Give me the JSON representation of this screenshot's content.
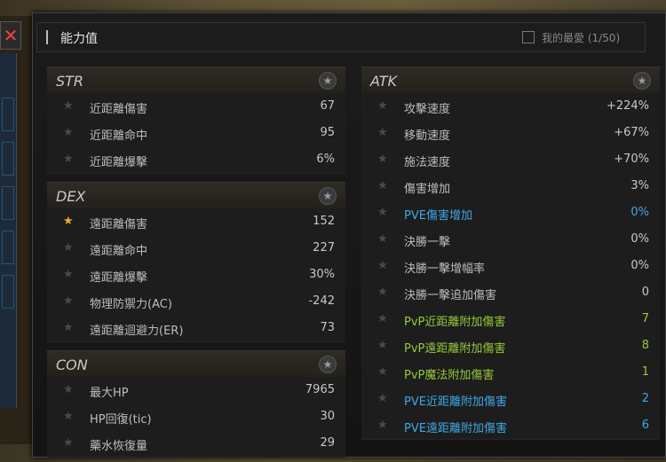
{
  "window": {
    "title": "能力值",
    "favorites_label": "我的最愛 (1/50)"
  },
  "sections": {
    "str": {
      "title": "STR",
      "rows": [
        {
          "label": "近距離傷害",
          "value": "67",
          "starred": false
        },
        {
          "label": "近距離命中",
          "value": "95",
          "starred": false
        },
        {
          "label": "近距離爆擊",
          "value": "6%",
          "starred": false
        }
      ]
    },
    "dex": {
      "title": "DEX",
      "rows": [
        {
          "label": "遠距離傷害",
          "value": "152",
          "starred": true
        },
        {
          "label": "遠距離命中",
          "value": "227",
          "starred": false
        },
        {
          "label": "遠距離爆擊",
          "value": "30%",
          "starred": false
        },
        {
          "label": "物理防禦力(AC)",
          "value": "-242",
          "starred": false
        },
        {
          "label": "遠距離迴避力(ER)",
          "value": "73",
          "starred": false
        }
      ]
    },
    "con": {
      "title": "CON",
      "rows": [
        {
          "label": "最大HP",
          "value": "7965",
          "starred": false
        },
        {
          "label": "HP回復(tic)",
          "value": "30",
          "starred": false
        },
        {
          "label": "藥水恢復量",
          "value": "29",
          "starred": false
        }
      ]
    },
    "atk": {
      "title": "ATK",
      "rows": [
        {
          "label": "攻擊速度",
          "value": "+224%",
          "color": "normal"
        },
        {
          "label": "移動速度",
          "value": "+67%",
          "color": "normal"
        },
        {
          "label": "施法速度",
          "value": "+70%",
          "color": "normal"
        },
        {
          "label": "傷害增加",
          "value": "3%",
          "color": "normal"
        },
        {
          "label": "PVE傷害增加",
          "value": "0%",
          "color": "blue"
        },
        {
          "label": "決勝一擊",
          "value": "0%",
          "color": "normal"
        },
        {
          "label": "決勝一擊增幅率",
          "value": "0%",
          "color": "normal"
        },
        {
          "label": "決勝一擊追加傷害",
          "value": "0",
          "color": "normal"
        },
        {
          "label": "PvP近距離附加傷害",
          "value": "7",
          "color": "green"
        },
        {
          "label": "PvP遠距離附加傷害",
          "value": "8",
          "color": "green"
        },
        {
          "label": "PvP魔法附加傷害",
          "value": "1",
          "color": "green"
        },
        {
          "label": "PVE近距離附加傷害",
          "value": "2",
          "color": "blue"
        },
        {
          "label": "PVE遠距離附加傷害",
          "value": "6",
          "color": "blue"
        }
      ]
    }
  },
  "colors": {
    "accent_blue": "#3fa8e6",
    "accent_green": "#98c93a",
    "star_on": "#f0b020"
  }
}
